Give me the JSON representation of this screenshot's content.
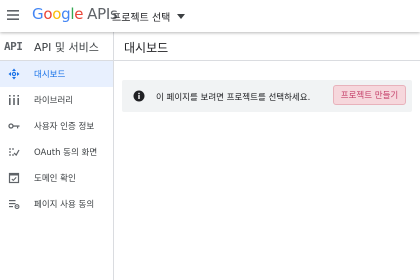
{
  "header": {
    "menu_icon": "hamburger-menu-icon",
    "logo": {
      "g1": "G",
      "g2": "o",
      "g3": "o",
      "g4": "g",
      "g5": "l",
      "g6": "e",
      "apis": "APIs"
    },
    "project_selector_label": "프로젝트 선택",
    "project_selector_icon": "caret-down-icon"
  },
  "sidebar": {
    "badge": "API",
    "title": "API 및 서비스",
    "items": [
      {
        "label": "대시보드",
        "icon": "dashboard-icon",
        "active": true
      },
      {
        "label": "라이브러리",
        "icon": "library-icon",
        "active": false
      },
      {
        "label": "사용자 인증 정보",
        "icon": "key-icon",
        "active": false
      },
      {
        "label": "OAuth 동의 화면",
        "icon": "consent-screen-icon",
        "active": false
      },
      {
        "label": "도메인 확인",
        "icon": "domain-verification-icon",
        "active": false
      },
      {
        "label": "페이지 사용 동의",
        "icon": "page-usage-agreement-icon",
        "active": false
      }
    ]
  },
  "main": {
    "title": "대시보드",
    "notice": {
      "icon": "info-icon",
      "text": "이 페이지를 보려면 프로젝트를 선택하세요.",
      "button_label": "프로젝트 만들기"
    }
  },
  "colors": {
    "active_nav_bg": "#e8f0fe",
    "active_nav_text": "#1a73e8",
    "notice_bg": "#f1f3f4",
    "button_bg": "#f6d7dc",
    "button_text": "#c5426b",
    "divider": "#dadce0"
  }
}
